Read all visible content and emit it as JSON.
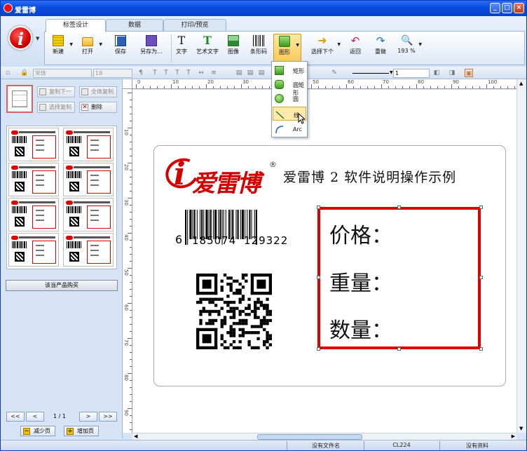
{
  "app": {
    "title": "爱雷博",
    "accent": "#0a4ee0",
    "brand_red": "#d40000"
  },
  "ribbon": {
    "tabs": [
      {
        "label": "标签设计",
        "active": true
      },
      {
        "label": "数据",
        "active": false
      },
      {
        "label": "打印/预览",
        "active": false
      }
    ],
    "buttons": {
      "new": "新建",
      "open": "打开",
      "save": "保存",
      "save_as": "另存为...",
      "text": "文字",
      "art_text": "艺术文字",
      "image": "图像",
      "barcode": "条形码",
      "shape": "图形",
      "next": "选择下个",
      "undo": "返回",
      "redo": "重做",
      "zoom": "193 %"
    }
  },
  "format_bar": {
    "font": "宋体",
    "size": "18",
    "line_width": "1"
  },
  "shape_menu": {
    "items": [
      {
        "label": "矩形",
        "icon": "rectangle-icon"
      },
      {
        "label": "圆矩形",
        "icon": "rounded-rectangle-icon"
      },
      {
        "label": "圆",
        "icon": "circle-icon"
      },
      {
        "label": "线",
        "icon": "line-icon",
        "highlighted": true
      },
      {
        "label": "Arc",
        "icon": "arc-icon"
      }
    ]
  },
  "left_panel": {
    "copy_next": "复制下一",
    "copy_all": "全体复制",
    "select_copy": "选择复制",
    "delete": "删除",
    "buy": "该当产品购买",
    "page_indicator": "1 / 1",
    "nav_first": "<<",
    "nav_prev": "<",
    "nav_next": ">",
    "nav_last": ">>",
    "remove_page": "减少页",
    "add_page": "增加页"
  },
  "label": {
    "logo_text": "爱雷博",
    "logo_reg": "®",
    "title": "爱雷博 2 软件说明操作示例",
    "barcode_lead": "6",
    "barcode_left": "185074",
    "barcode_right": "129322",
    "price": "价格：",
    "weight": "重量：",
    "quantity": "数量："
  },
  "status_bar": {
    "file": "没有文件名",
    "model": "CL224",
    "info": "没有资料"
  }
}
